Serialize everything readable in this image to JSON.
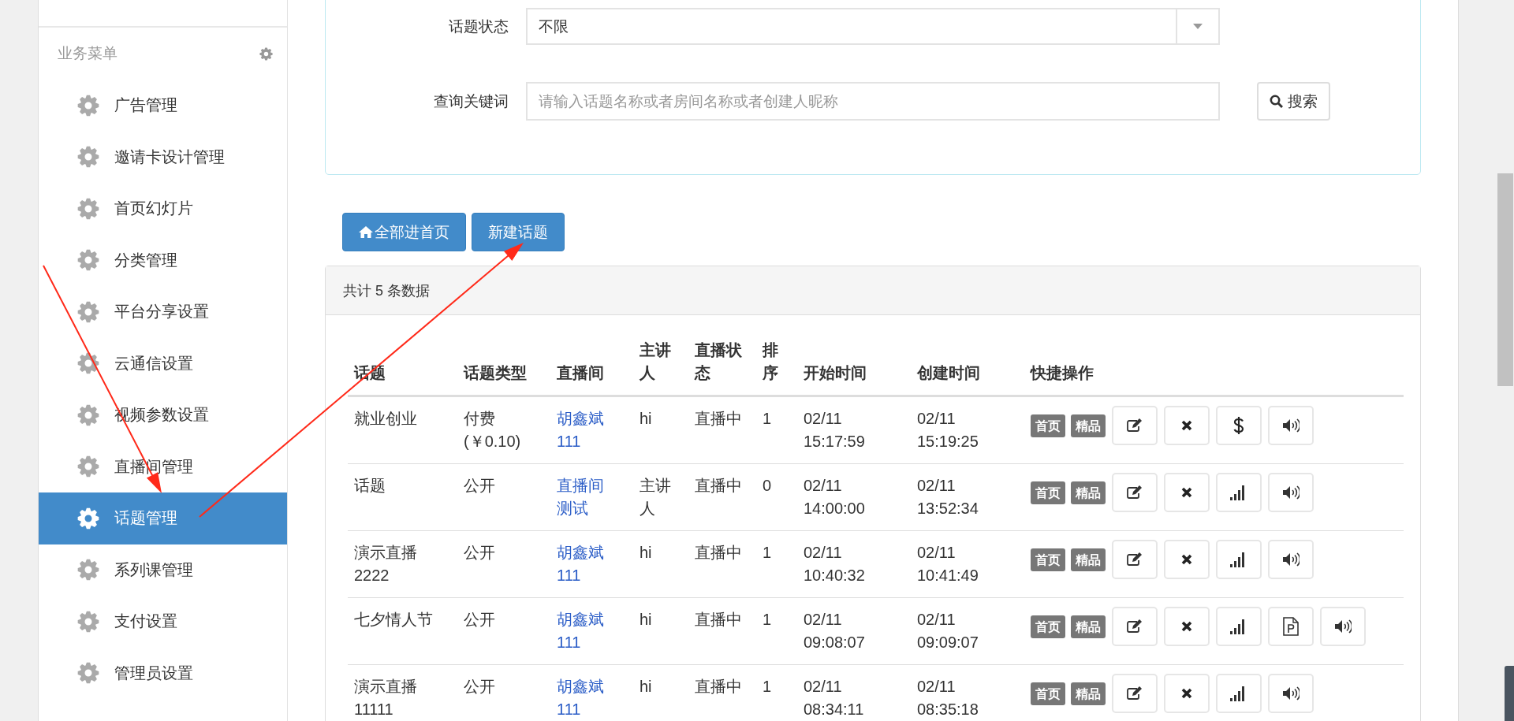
{
  "sidebar": {
    "section_title": "业务菜单",
    "items": [
      {
        "label": "广告管理",
        "selected": false
      },
      {
        "label": "邀请卡设计管理",
        "selected": false
      },
      {
        "label": "首页幻灯片",
        "selected": false
      },
      {
        "label": "分类管理",
        "selected": false
      },
      {
        "label": "平台分享设置",
        "selected": false
      },
      {
        "label": "云通信设置",
        "selected": false
      },
      {
        "label": "视频参数设置",
        "selected": false
      },
      {
        "label": "直播间管理",
        "selected": false
      },
      {
        "label": "话题管理",
        "selected": true
      },
      {
        "label": "系列课管理",
        "selected": false
      },
      {
        "label": "支付设置",
        "selected": false
      },
      {
        "label": "管理员设置",
        "selected": false
      }
    ]
  },
  "filters": [
    {
      "kind": "select",
      "label": "话题状态",
      "value": "不限"
    },
    {
      "kind": "text",
      "label": "查询关键词",
      "placeholder": "请输入话题名称或者房间名称或者创建人昵称"
    }
  ],
  "search_button": "搜索",
  "toolbar": [
    {
      "kind": "home",
      "label": "全部进首页"
    },
    {
      "kind": "plain",
      "label": "新建话题"
    }
  ],
  "table": {
    "summary": "共计 5 条数据",
    "columns": [
      "话题",
      "话题类型",
      "直播间",
      "主讲人",
      "直播状态",
      "排序",
      "开始时间",
      "创建时间",
      "快捷操作"
    ],
    "rows": [
      {
        "topic": "就业创业",
        "type": "付费(￥0.10)",
        "room": "胡鑫斌111",
        "host": "hi",
        "status": "直播中",
        "order": "1",
        "start": "02/11 15:17:59",
        "created": "02/11 15:19:25",
        "badges": [
          "首页",
          "精品"
        ],
        "actions": [
          {
            "kind": "edit"
          },
          {
            "kind": "delete"
          },
          {
            "kind": "price"
          },
          {
            "kind": "volume"
          }
        ]
      },
      {
        "topic": "话题",
        "type": "公开",
        "room": "直播间测试",
        "host": "主讲人",
        "status": "直播中",
        "order": "0",
        "start": "02/11 14:00:00",
        "created": "02/11 13:52:34",
        "badges": [
          "首页",
          "精品"
        ],
        "actions": [
          {
            "kind": "edit"
          },
          {
            "kind": "delete"
          },
          {
            "kind": "signal"
          },
          {
            "kind": "volume"
          }
        ]
      },
      {
        "topic": "演示直播2222",
        "type": "公开",
        "room": "胡鑫斌111",
        "host": "hi",
        "status": "直播中",
        "order": "1",
        "start": "02/11 10:40:32",
        "created": "02/11 10:41:49",
        "badges": [
          "首页",
          "精品"
        ],
        "actions": [
          {
            "kind": "edit"
          },
          {
            "kind": "delete"
          },
          {
            "kind": "signal"
          },
          {
            "kind": "volume"
          }
        ]
      },
      {
        "topic": "七夕情人节",
        "type": "公开",
        "room": "胡鑫斌111",
        "host": "hi",
        "status": "直播中",
        "order": "1",
        "start": "02/11 09:08:07",
        "created": "02/11 09:09:07",
        "badges": [
          "首页",
          "精品"
        ],
        "actions": [
          {
            "kind": "edit"
          },
          {
            "kind": "delete"
          },
          {
            "kind": "signal"
          },
          {
            "kind": "document"
          },
          {
            "kind": "volume"
          }
        ]
      },
      {
        "topic": "演示直播11111",
        "type": "公开",
        "room": "胡鑫斌111",
        "host": "hi",
        "status": "直播中",
        "order": "1",
        "start": "02/11 08:34:11",
        "created": "02/11 08:35:18",
        "badges": [
          "首页",
          "精品"
        ],
        "actions": [
          {
            "kind": "edit"
          },
          {
            "kind": "delete"
          },
          {
            "kind": "signal"
          },
          {
            "kind": "volume"
          }
        ]
      }
    ]
  }
}
